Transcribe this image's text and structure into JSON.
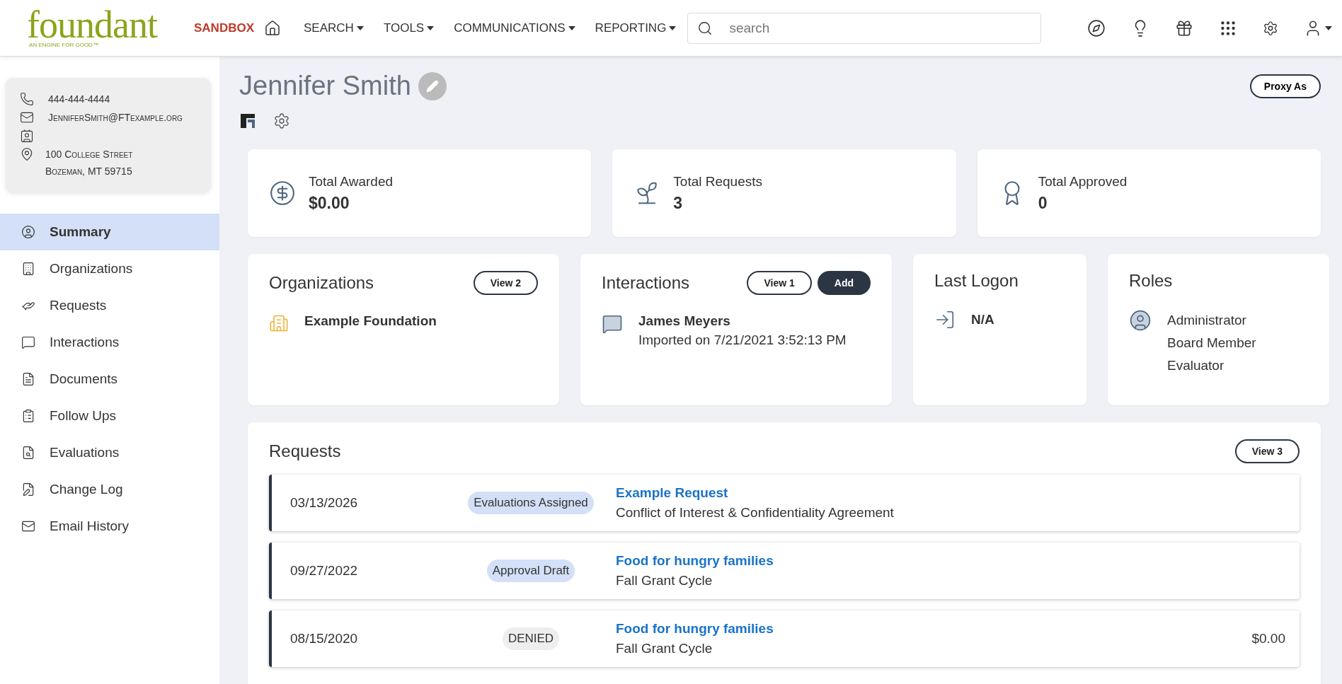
{
  "header": {
    "logo": {
      "name": "foundant",
      "tagline": "AN ENGINE FOR GOOD™"
    },
    "environment": "SANDBOX",
    "menus": [
      {
        "label": "SEARCH"
      },
      {
        "label": "TOOLS"
      },
      {
        "label": "COMMUNICATIONS"
      },
      {
        "label": "REPORTING"
      }
    ],
    "search": {
      "placeholder": "search"
    }
  },
  "contact": {
    "phone": "444-444-4444",
    "email": "JenniferSmith@FTexample.org",
    "address_lines": [
      "100 College Street",
      "Bozeman, MT 59715"
    ]
  },
  "sidebar": {
    "items": [
      {
        "label": "Summary",
        "selected": true
      },
      {
        "label": "Organizations",
        "selected": false
      },
      {
        "label": "Requests",
        "selected": false
      },
      {
        "label": "Interactions",
        "selected": false
      },
      {
        "label": "Documents",
        "selected": false
      },
      {
        "label": "Follow Ups",
        "selected": false
      },
      {
        "label": "Evaluations",
        "selected": false
      },
      {
        "label": "Change Log",
        "selected": false
      },
      {
        "label": "Email History",
        "selected": false
      }
    ]
  },
  "profile": {
    "name": "Jennifer Smith",
    "proxy_button": "Proxy As"
  },
  "stats": [
    {
      "kind": "money",
      "label": "Total Awarded",
      "value": "$0.00"
    },
    {
      "kind": "requests",
      "label": "Total Requests",
      "value": "3"
    },
    {
      "kind": "approved",
      "label": "Total Approved",
      "value": "0"
    }
  ],
  "organizations": {
    "title": "Organizations",
    "view_button": "View 2",
    "items": [
      "Example Foundation"
    ]
  },
  "interactions": {
    "title": "Interactions",
    "view_button": "View 1",
    "add_button": "Add",
    "items": [
      {
        "name": "James Meyers",
        "detail": "Imported on 7/21/2021 3:52:13 PM"
      }
    ]
  },
  "last_logon": {
    "title": "Last Logon",
    "value": "N/A"
  },
  "roles": {
    "title": "Roles",
    "items": [
      "Administrator",
      "Board Member",
      "Evaluator"
    ]
  },
  "requests": {
    "title": "Requests",
    "view_button": "View 3",
    "rows": [
      {
        "date": "03/13/2026",
        "status": "Evaluations Assigned",
        "color": "#d3e0f7",
        "title": "Example Request",
        "subtitle": "Conflict of Interest & Confidentiality Agreement"
      },
      {
        "date": "09/27/2022",
        "status": "Approval Draft",
        "color": "#d3e0f7",
        "title": "Food for hungry families",
        "subtitle": "Fall Grant Cycle"
      },
      {
        "date": "08/15/2020",
        "status": "DENIED",
        "color": "#eeeeee",
        "title": "Food for hungry families",
        "subtitle": "Fall Grant Cycle",
        "amount": "$0.00"
      }
    ]
  }
}
